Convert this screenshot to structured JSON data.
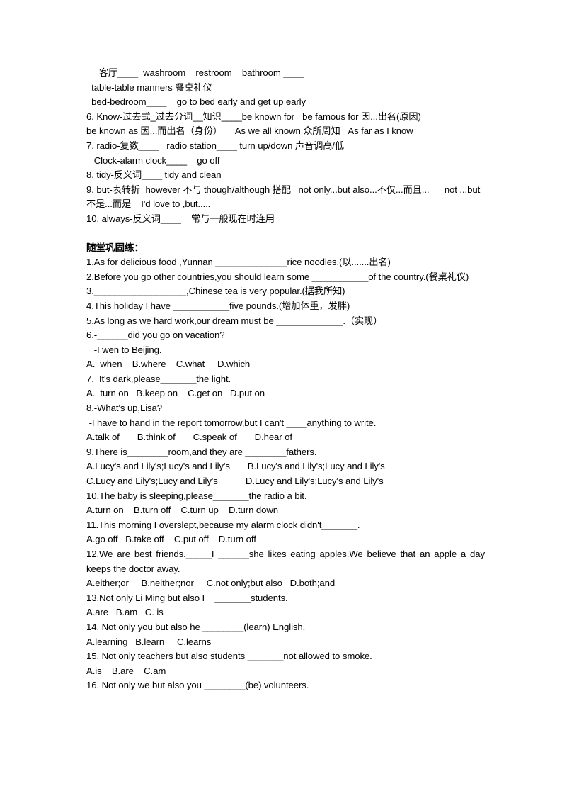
{
  "document": {
    "type": "worksheet-page",
    "language": "zh-CN/en",
    "section_heading": "随堂巩固练：",
    "notes_lines": [
      "     客厅____  washroom    restroom    bathroom ____",
      "  table-table manners 餐桌礼仪",
      "  bed-bedroom____    go to bed early and get up early",
      "6. Know-过去式_过去分词__知识____be known for =be famous for 因...出名(原因)",
      "be known as 因...而出名（身份）     As we all known 众所周知   As far as I know",
      "7. radio-复数____   radio station____ turn up/down 声音调高/低",
      "   Clock-alarm clock____    go off",
      "8. tidy-反义词____ tidy and clean",
      "9. but-表转折=however 不与 though/although 搭配   not only...but also...不仅...而且...      not ...but 不是...而是    I'd love to ,but.....",
      "10. always-反义词____    常与一般现在时连用"
    ],
    "exercises": [
      {
        "id": "1",
        "stem": "1.As for delicious food ,Yunnan ______________rice noodles.(以.......出名)",
        "options": []
      },
      {
        "id": "2",
        "stem": "2.Before you go other countries,you should learn some ___________of the country.(餐桌礼仪)",
        "options": []
      },
      {
        "id": "3",
        "stem": "3.__________________,Chinese tea is very popular.(据我所知)",
        "options": []
      },
      {
        "id": "4",
        "stem": "4.This holiday I have ___________five pounds.(增加体重，发胖)",
        "options": []
      },
      {
        "id": "5",
        "stem": "5.As long as we hard work,our dream must be _____________.（实现）",
        "options": []
      },
      {
        "id": "6",
        "stem": "6.-______did you go on vacation?",
        "reply": "   -I wen to Beijing.",
        "options": "A.  when    B.where    C.what     D.which"
      },
      {
        "id": "7",
        "stem": "7.  It's dark,please_______the light.",
        "options": "A.  turn on   B.keep on    C.get on   D.put on"
      },
      {
        "id": "8",
        "stem": "8.-What's up,Lisa?",
        "reply": " -I have to hand in the report tomorrow,but I can't ____anything to write.",
        "options": "A.talk of       B.think of       C.speak of       D.hear of"
      },
      {
        "id": "9",
        "stem": "9.There is________room,and they are ________fathers.",
        "options_a": "A.Lucy's and Lily's;Lucy's and Lily's       B.Lucy's and Lily's;Lucy and Lily's",
        "options_b": "C.Lucy and Lily's;Lucy and Lily's           D.Lucy and Lily's;Lucy's and Lily's"
      },
      {
        "id": "10",
        "stem": "10.The baby is sleeping,please_______the radio a bit.",
        "options": "A.turn on    B.turn off    C.turn up    D.turn down"
      },
      {
        "id": "11",
        "stem": "11.This morning I overslept,because my alarm clock didn't_______.",
        "options": "A.go off   B.take off    C.put off    D.turn off"
      },
      {
        "id": "12",
        "stem": "12.We are best friends._____I ______she likes eating apples.We believe that an apple a day keeps the doctor away.",
        "options": "A.either;or     B.neither;nor     C.not only;but also   D.both;and"
      },
      {
        "id": "13",
        "stem": "13.Not only Li Ming but also I    _______students.",
        "options": "A.are   B.am   C. is"
      },
      {
        "id": "14",
        "stem": "14. Not only you but also he ________(learn) English.",
        "options": "A.learning   B.learn     C.learns"
      },
      {
        "id": "15",
        "stem": "15. Not only teachers but also students _______not allowed to smoke.",
        "options": "A.is    B.are    C.am"
      },
      {
        "id": "16",
        "stem": "16. Not only we but also you ________(be) volunteers.",
        "options": ""
      }
    ]
  }
}
